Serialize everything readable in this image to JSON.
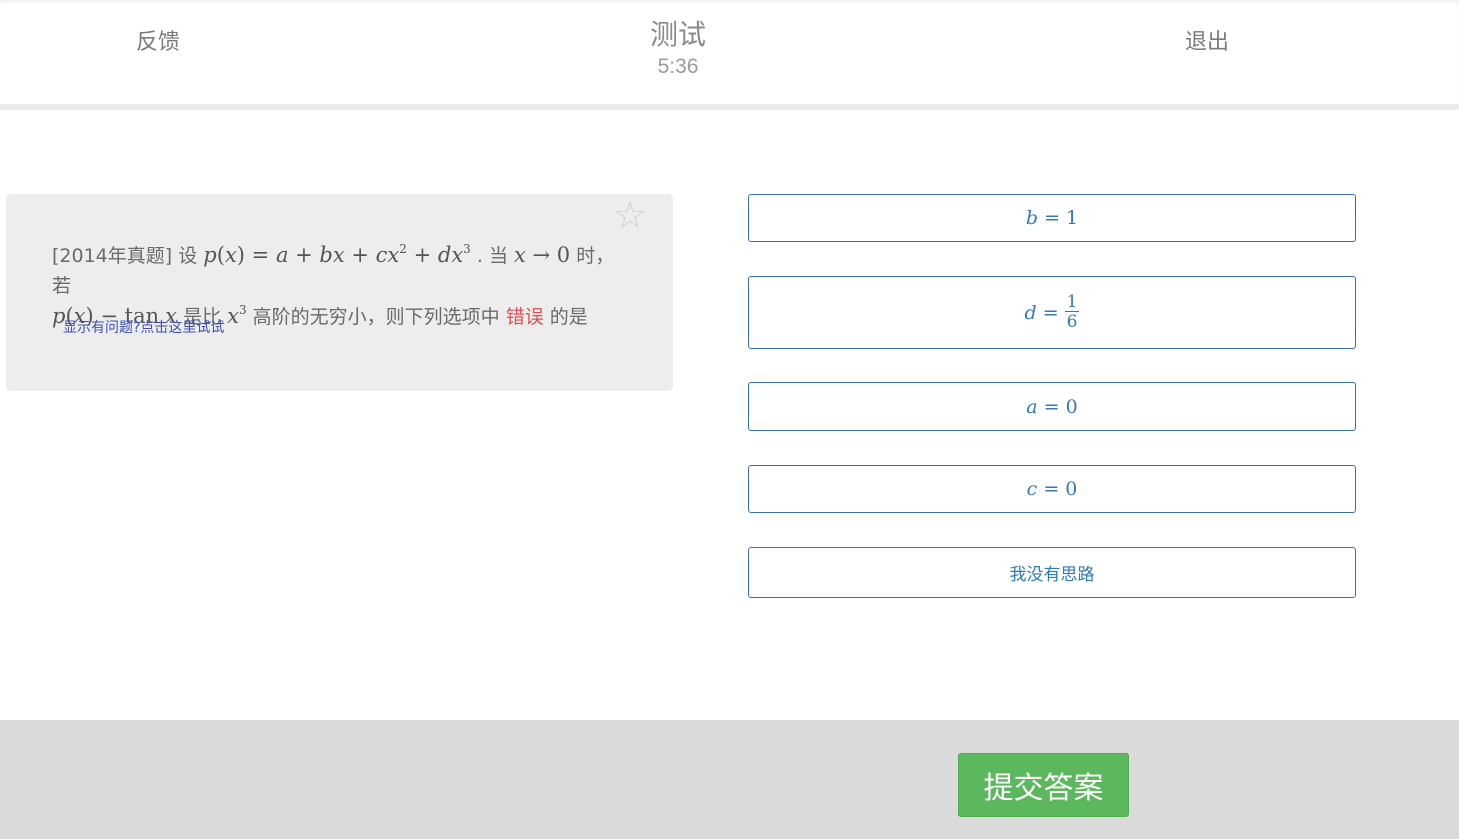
{
  "header": {
    "feedback_label": "反馈",
    "title": "测试",
    "timer": "5:36",
    "exit_label": "退出"
  },
  "question": {
    "source_tag": "[2014年真题]",
    "text_1": "设",
    "text_2": ". 当",
    "text_3": "时，若",
    "text_4": "是比",
    "text_5": "高阶的无穷小，则下列选项中",
    "error_word": "错误",
    "text_6": "的是",
    "hint_link": "显示有问题?点击这里试试",
    "star_icon": "star-outline-icon"
  },
  "options": [
    {
      "var": "b",
      "eq": "=",
      "value": "1"
    },
    {
      "var": "d",
      "eq": "=",
      "num": "1",
      "den": "6"
    },
    {
      "var": "a",
      "eq": "=",
      "value": "0"
    },
    {
      "var": "c",
      "eq": "=",
      "value": "0"
    },
    {
      "text": "我没有思路"
    }
  ],
  "footer": {
    "submit_label": "提交答案"
  },
  "colors": {
    "accent": "#2f7ab8",
    "submit": "#5cb85c",
    "error": "#e05252",
    "card_bg": "#ededed",
    "footer_bg": "#dadada"
  }
}
